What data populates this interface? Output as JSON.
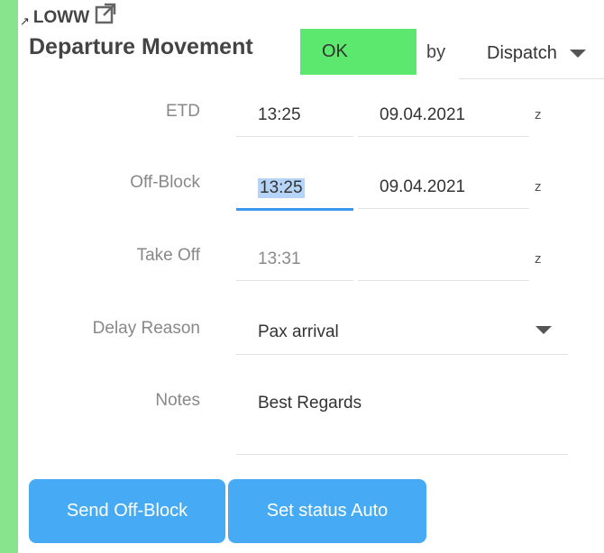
{
  "header": {
    "airport_code": "LOWW",
    "title": "Departure Movement",
    "status": "OK",
    "by_label": "by",
    "by_value": "Dispatch"
  },
  "form": {
    "etd": {
      "label": "ETD",
      "time": "13:25",
      "date": "09.04.2021",
      "tz": "z"
    },
    "off_block": {
      "label": "Off-Block",
      "time": "13:25",
      "date": "09.04.2021",
      "tz": "z"
    },
    "take_off": {
      "label": "Take Off",
      "time": "13:31",
      "date": "",
      "tz": "z"
    },
    "delay_reason": {
      "label": "Delay Reason",
      "value": "Pax arrival"
    },
    "notes": {
      "label": "Notes",
      "value": "Best Regards"
    }
  },
  "actions": {
    "send_off_block": "Send Off-Block",
    "set_status_auto": "Set status Auto"
  },
  "colors": {
    "accent_bar": "#88e58e",
    "status_ok": "#5ce86f",
    "button": "#47aaf5",
    "active_underline": "#3c97ee"
  }
}
